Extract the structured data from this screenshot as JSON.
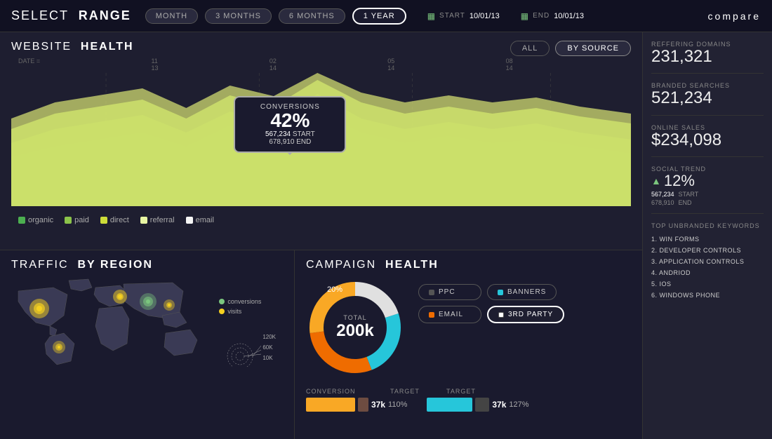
{
  "nav": {
    "title_light": "SELECT",
    "title_bold": "RANGE",
    "ranges": [
      {
        "label": "MONTH",
        "active": false
      },
      {
        "label": "3 MONTHS",
        "active": false
      },
      {
        "label": "6 MONTHS",
        "active": false
      },
      {
        "label": "1 YEAR",
        "active": true
      }
    ],
    "start_label": "START",
    "start_date": "10/01/13",
    "end_label": "END",
    "end_date": "10/01/13",
    "compare_label": "compare"
  },
  "website_health": {
    "title_light": "WEBSITE",
    "title_bold": "HEALTH",
    "filter_all": "ALL",
    "filter_source": "BY SOURCE",
    "date_label": "DATE =",
    "dates": [
      "11\n13",
      "02\n14",
      "05\n14",
      "08\n14"
    ],
    "tooltip": {
      "label": "CONVERSIONS",
      "pct": "42%",
      "start_label": "START",
      "start_val": "567,234",
      "end_label": "END",
      "end_val": "678,910"
    },
    "legend": [
      {
        "label": "organic",
        "color": "#4caf50"
      },
      {
        "label": "paid",
        "color": "#8bc34a"
      },
      {
        "label": "direct",
        "color": "#cddc39"
      },
      {
        "label": "referral",
        "color": "#e8f5a3"
      },
      {
        "label": "email",
        "color": "#f5f5f5"
      }
    ]
  },
  "traffic": {
    "title_light": "TRAFFIC",
    "title_bold": "BY REGION",
    "legend": {
      "conversions": "conversions",
      "visits": "visits"
    },
    "scale": [
      "120K",
      "60K",
      "10K"
    ]
  },
  "campaign": {
    "title_light": "CAMPAIGN",
    "title_bold": "HEALTH",
    "donut_pct": "20%",
    "total_label": "TOTAL",
    "total_val": "200k",
    "buttons": [
      {
        "label": "PPC",
        "color": "#555",
        "active": false
      },
      {
        "label": "BANNERS",
        "color": "#26c6da",
        "active": false
      },
      {
        "label": "EMAIL",
        "color": "#ef6c00",
        "active": false
      },
      {
        "label": "3RD PARTY",
        "color": "#fff",
        "active": true
      }
    ],
    "conversion_header": "CONVERSION",
    "target_header": "TARGET",
    "bar1_val": "37k",
    "bar1_pct": "110%",
    "bar2_val": "37k",
    "bar2_pct": "127%"
  },
  "sidebar": {
    "referring_label": "REFFERING DOMAINS",
    "referring_val": "231,321",
    "branded_label": "BRANDED SEARCHES",
    "branded_val": "521,234",
    "sales_label": "ONLINE SALES",
    "sales_val": "$234,098",
    "trend_label": "SOCIAL TREND",
    "trend_pct": "12%",
    "trend_start_val": "567,234",
    "trend_start_label": "START",
    "trend_end_val": "678,910",
    "trend_end_label": "END",
    "keywords_title": "TOP UNBRANDED KEYWORDS",
    "keywords": [
      "1. WIN FORMS",
      "2. DEVELOPER CONTROLS",
      "3. APPLICATION CONTROLS",
      "4. ANDRIOD",
      "5. IOS",
      "6. WINDOWS PHONE"
    ]
  }
}
